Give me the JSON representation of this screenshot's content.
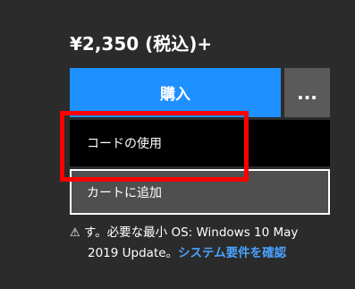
{
  "price": {
    "text": "¥2,350 (税込)+"
  },
  "buttons": {
    "buy_label": "購入",
    "more_label": "..."
  },
  "menu": {
    "items": [
      {
        "label": "コードの使用"
      },
      {
        "label": "カートに追加"
      }
    ]
  },
  "requirements": {
    "icon": "warning-icon",
    "icon_glyph": "⚠",
    "line1": "す。必要な最小 OS: Windows 10 May",
    "line2_text": "2019 Update。",
    "link_label": "システム要件を確認"
  },
  "colors": {
    "background": "#2b2b2b",
    "buy_button": "#1e90ff",
    "more_button": "#5a5a5a",
    "highlight": "#ff0000",
    "link": "#4aa3ff"
  }
}
